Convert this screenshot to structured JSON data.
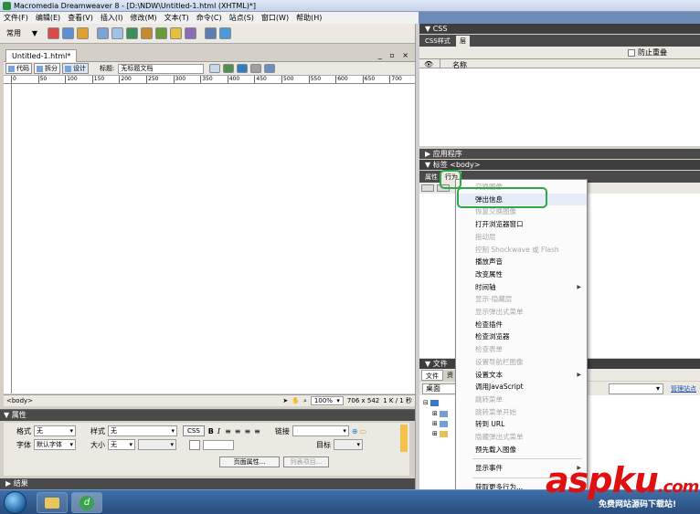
{
  "window": {
    "title": "Macromedia Dreamweaver 8 - [D:\\NDW\\Untitled-1.html (XHTML)*]"
  },
  "menubar": [
    "文件(F)",
    "编辑(E)",
    "查看(V)",
    "插入(I)",
    "修改(M)",
    "文本(T)",
    "命令(C)",
    "站点(S)",
    "窗口(W)",
    "帮助(H)"
  ],
  "insert_bar": {
    "category": "常用"
  },
  "document": {
    "tab": "Untitled-1.html*",
    "views": {
      "code": "代码",
      "split": "拆分",
      "design": "设计"
    },
    "title_label": "标题:",
    "title_value": "无标题文档",
    "ruler_ticks": [
      "0",
      "50",
      "100",
      "150",
      "200",
      "250",
      "300",
      "350",
      "400",
      "450",
      "500",
      "550",
      "600",
      "650",
      "700"
    ],
    "status": {
      "tag": "<body>",
      "zoom": "100%",
      "size": "706 x 542",
      "download": "1 K / 1 秒"
    }
  },
  "properties": {
    "header": "属性",
    "format_label": "格式",
    "format_value": "无",
    "style_label": "样式",
    "style_value": "无",
    "css_btn": "CSS",
    "link_label": "链接",
    "font_label": "字体",
    "font_value": "默认字体",
    "size_label": "大小",
    "size_value": "无",
    "target_label": "目标",
    "page_props": "页面属性...",
    "list_item": "列表项目..."
  },
  "results_panel": "结果",
  "css_panel": {
    "header": "CSS",
    "tabs": [
      "CSS样式",
      "层"
    ],
    "prevent_overlap": "防止重叠",
    "name_col": "名称"
  },
  "app_panel": "应用程序",
  "tag_panel": {
    "header": "标签 <body>",
    "tabs": [
      "属性",
      "行为"
    ]
  },
  "files_panel": {
    "header": "文件",
    "tabs": [
      "文件",
      "资"
    ],
    "site": "桌面",
    "manage": "管理站点"
  },
  "behaviors_menu": {
    "items": [
      {
        "label": "交换图像",
        "enabled": false
      },
      {
        "label": "弹出信息",
        "enabled": true,
        "highlight": true
      },
      {
        "label": "恢复交换图像",
        "enabled": false
      },
      {
        "label": "打开浏览器窗口",
        "enabled": true
      },
      {
        "label": "拖动层",
        "enabled": false
      },
      {
        "label": "控制 Shockwave 或 Flash",
        "enabled": false
      },
      {
        "label": "播放声音",
        "enabled": true
      },
      {
        "label": "改变属性",
        "enabled": true
      },
      {
        "label": "时间轴",
        "enabled": true,
        "submenu": true
      },
      {
        "label": "显示-隐藏层",
        "enabled": false
      },
      {
        "label": "显示弹出式菜单",
        "enabled": false
      },
      {
        "label": "检查插件",
        "enabled": true
      },
      {
        "label": "检查浏览器",
        "enabled": true
      },
      {
        "label": "检查表单",
        "enabled": false
      },
      {
        "label": "设置导航栏图像",
        "enabled": false
      },
      {
        "label": "设置文本",
        "enabled": true,
        "submenu": true
      },
      {
        "label": "调用JavaScript",
        "enabled": true
      },
      {
        "label": "跳转菜单",
        "enabled": false
      },
      {
        "label": "跳转菜单开始",
        "enabled": false
      },
      {
        "label": "转到 URL",
        "enabled": true
      },
      {
        "label": "隐藏弹出式菜单",
        "enabled": false
      },
      {
        "label": "预先载入图像",
        "enabled": true
      },
      {
        "label": "显示事件",
        "enabled": true,
        "submenu": true
      },
      {
        "label": "获取更多行为...",
        "enabled": true
      }
    ]
  },
  "watermark": {
    "brand": "aspku",
    "suffix": ".com",
    "slogan": "免费网站源码下载站!"
  },
  "colors": {
    "annotation": "#2fa84a",
    "watermark": "#e01010",
    "panel_header": "#3e3e3e"
  }
}
